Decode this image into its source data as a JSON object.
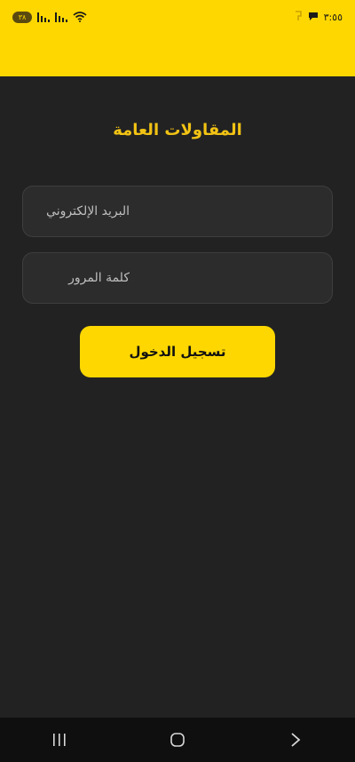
{
  "status_bar": {
    "battery_level": "٣٨",
    "time": "٣:٥٥"
  },
  "app": {
    "title": "المقاولات العامة"
  },
  "form": {
    "email_placeholder": "البريد الإلكتروني",
    "password_placeholder": "كلمة المرور",
    "login_label": "تسجيل الدخول"
  },
  "colors": {
    "accent": "#FFD700",
    "title": "#F2C314",
    "background": "#222222",
    "field": "#2C2C2C"
  },
  "icons": {
    "nav_recent": "recent-apps-icon",
    "nav_home": "home-icon",
    "nav_back": "back-icon"
  }
}
